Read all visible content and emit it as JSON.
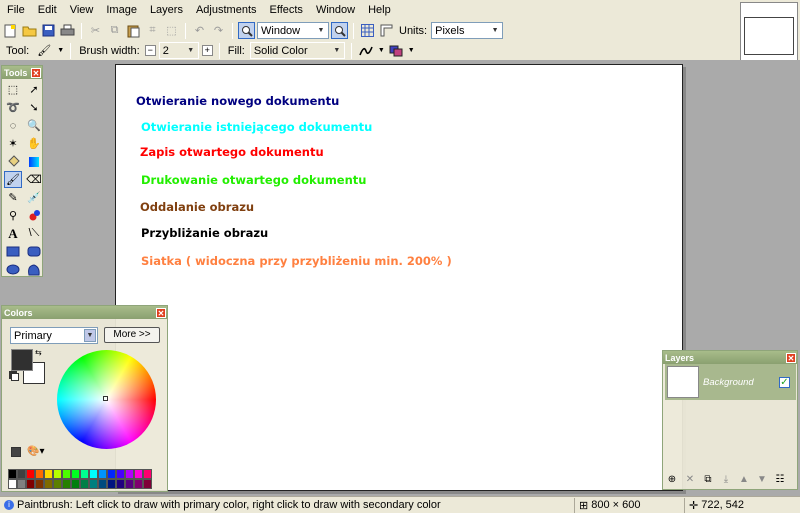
{
  "menu": [
    "File",
    "Edit",
    "View",
    "Image",
    "Layers",
    "Adjustments",
    "Effects",
    "Window",
    "Help"
  ],
  "toolbar": {
    "zoom_value": "Window",
    "units_label": "Units:",
    "units_value": "Pixels",
    "tool_label": "Tool:",
    "brush_width_label": "Brush width:",
    "brush_width_value": "2",
    "fill_label": "Fill:",
    "fill_value": "Solid Color",
    "minus": "⊟",
    "plus": "⊞"
  },
  "tools_window": {
    "title": "Tools",
    "close": "✕"
  },
  "colors_window": {
    "title": "Colors",
    "close": "✕",
    "mode": "Primary",
    "more_button": "More >>",
    "primary_color": "#303030",
    "secondary_color": "#ffffff"
  },
  "layers_window": {
    "title": "Layers",
    "close": "✕",
    "layer_name": "Background",
    "visible_check": "✓"
  },
  "canvas": {
    "lines": [
      {
        "text": "Otwieranie nowego dokumentu",
        "color": "#000080"
      },
      {
        "text": "Otwieranie istniejącego dokumentu",
        "color": "#00ffff"
      },
      {
        "text": "Zapis otwartego dokumentu",
        "color": "#ff0000"
      },
      {
        "text": "Drukowanie otwartego dokumentu",
        "color": "#22ee00"
      },
      {
        "text": "Oddalanie obrazu",
        "color": "#804010"
      },
      {
        "text": "Przybliżanie obrazu",
        "color": "#000000"
      },
      {
        "text": "Siatka ( widoczna przy przybliżeniu min. 200% )",
        "color": "#ff8040"
      }
    ]
  },
  "status": {
    "message": "Paintbrush: Left click to draw with primary color, right click to draw with secondary color",
    "image_size": "800 × 600",
    "cursor_pos": "722, 542"
  },
  "palette": [
    "#000000",
    "#404040",
    "#ff0000",
    "#ff6a00",
    "#ffd800",
    "#b6ff00",
    "#4cff00",
    "#00ff21",
    "#00ff90",
    "#00ffff",
    "#0094ff",
    "#0026ff",
    "#4800ff",
    "#b200ff",
    "#ff00dc",
    "#ff006e"
  ]
}
